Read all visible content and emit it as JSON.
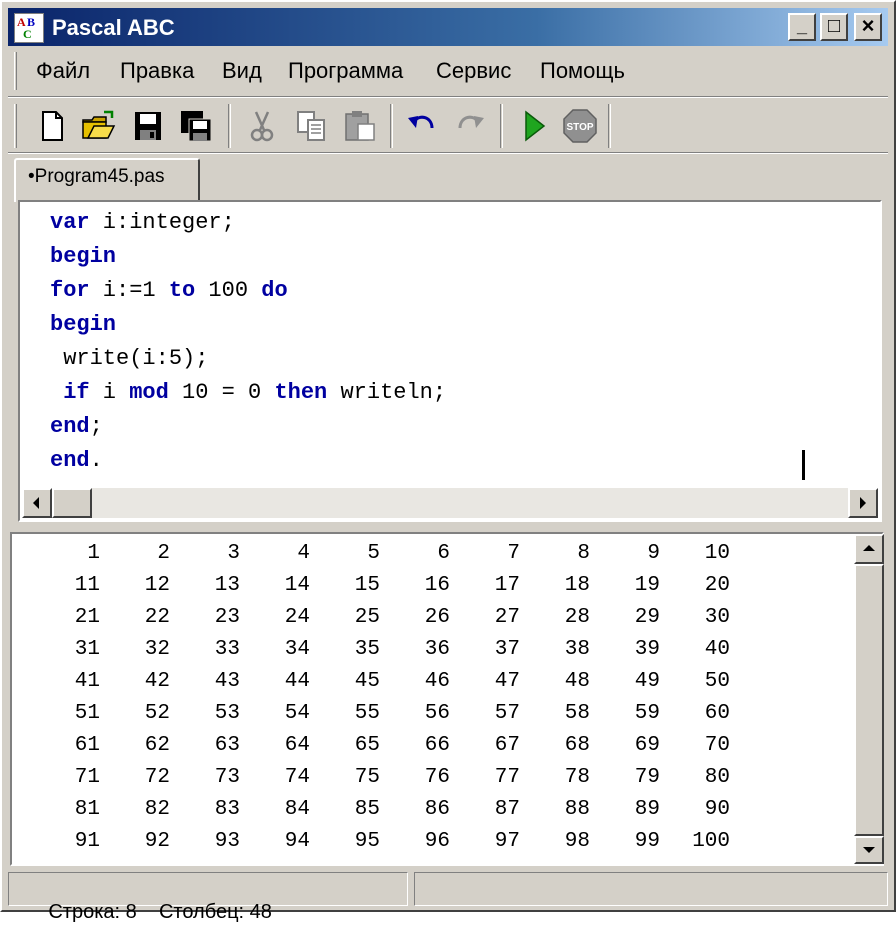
{
  "window": {
    "title": "Pascal ABC"
  },
  "app_icon": {
    "letters": [
      "A",
      "B",
      "C"
    ]
  },
  "title_buttons": {
    "minimize": "_",
    "maximize": "□",
    "close": "×"
  },
  "menu": {
    "items": [
      "Файл",
      "Правка",
      "Вид",
      "Программа",
      "Сервис",
      "Помощь"
    ]
  },
  "toolbar": {
    "icons": [
      "new-file-icon",
      "open-folder-icon",
      "save-icon",
      "save-all-icon",
      "cut-icon",
      "copy-icon",
      "paste-icon",
      "undo-icon",
      "redo-icon",
      "run-icon",
      "stop-icon"
    ],
    "stop_label": "STOP"
  },
  "tab": {
    "label": "•Program45.pas"
  },
  "editor": {
    "lines": [
      [
        {
          "t": "var",
          "kw": true
        },
        {
          "t": " i:integer;",
          "kw": false
        }
      ],
      [
        {
          "t": "begin",
          "kw": true
        }
      ],
      [
        {
          "t": "for",
          "kw": true
        },
        {
          "t": " i:=1 ",
          "kw": false
        },
        {
          "t": "to",
          "kw": true
        },
        {
          "t": " 100 ",
          "kw": false
        },
        {
          "t": "do",
          "kw": true
        }
      ],
      [
        {
          "t": "begin",
          "kw": true
        }
      ],
      [
        {
          "t": " write(i:5);",
          "kw": false
        }
      ],
      [
        {
          "t": " if",
          "kw": true
        },
        {
          "t": " i ",
          "kw": false
        },
        {
          "t": "mod",
          "kw": true
        },
        {
          "t": " 10 = 0 ",
          "kw": false
        },
        {
          "t": "then",
          "kw": true
        },
        {
          "t": " writeln;",
          "kw": false
        }
      ],
      [
        {
          "t": "end",
          "kw": true
        },
        {
          "t": ";",
          "kw": false
        }
      ],
      [
        {
          "t": "end",
          "kw": true
        },
        {
          "t": ".",
          "kw": false
        }
      ]
    ]
  },
  "output": {
    "rows": [
      [
        "1",
        "2",
        "3",
        "4",
        "5",
        "6",
        "7",
        "8",
        "9",
        "10"
      ],
      [
        "11",
        "12",
        "13",
        "14",
        "15",
        "16",
        "17",
        "18",
        "19",
        "20"
      ],
      [
        "21",
        "22",
        "23",
        "24",
        "25",
        "26",
        "27",
        "28",
        "29",
        "30"
      ],
      [
        "31",
        "32",
        "33",
        "34",
        "35",
        "36",
        "37",
        "38",
        "39",
        "40"
      ],
      [
        "41",
        "42",
        "43",
        "44",
        "45",
        "46",
        "47",
        "48",
        "49",
        "50"
      ],
      [
        "51",
        "52",
        "53",
        "54",
        "55",
        "56",
        "57",
        "58",
        "59",
        "60"
      ],
      [
        "61",
        "62",
        "63",
        "64",
        "65",
        "66",
        "67",
        "68",
        "69",
        "70"
      ],
      [
        "71",
        "72",
        "73",
        "74",
        "75",
        "76",
        "77",
        "78",
        "79",
        "80"
      ],
      [
        "81",
        "82",
        "83",
        "84",
        "85",
        "86",
        "87",
        "88",
        "89",
        "90"
      ],
      [
        "91",
        "92",
        "93",
        "94",
        "95",
        "96",
        "97",
        "98",
        "99",
        "100"
      ]
    ]
  },
  "status": {
    "row": "Строка: 8",
    "column": "Столбец: 48"
  },
  "colors": {
    "keyword": "#0000a0",
    "title_gradient_start": "#0a246a",
    "title_gradient_end": "#a6caf0",
    "run_green": "#1fa51f"
  }
}
